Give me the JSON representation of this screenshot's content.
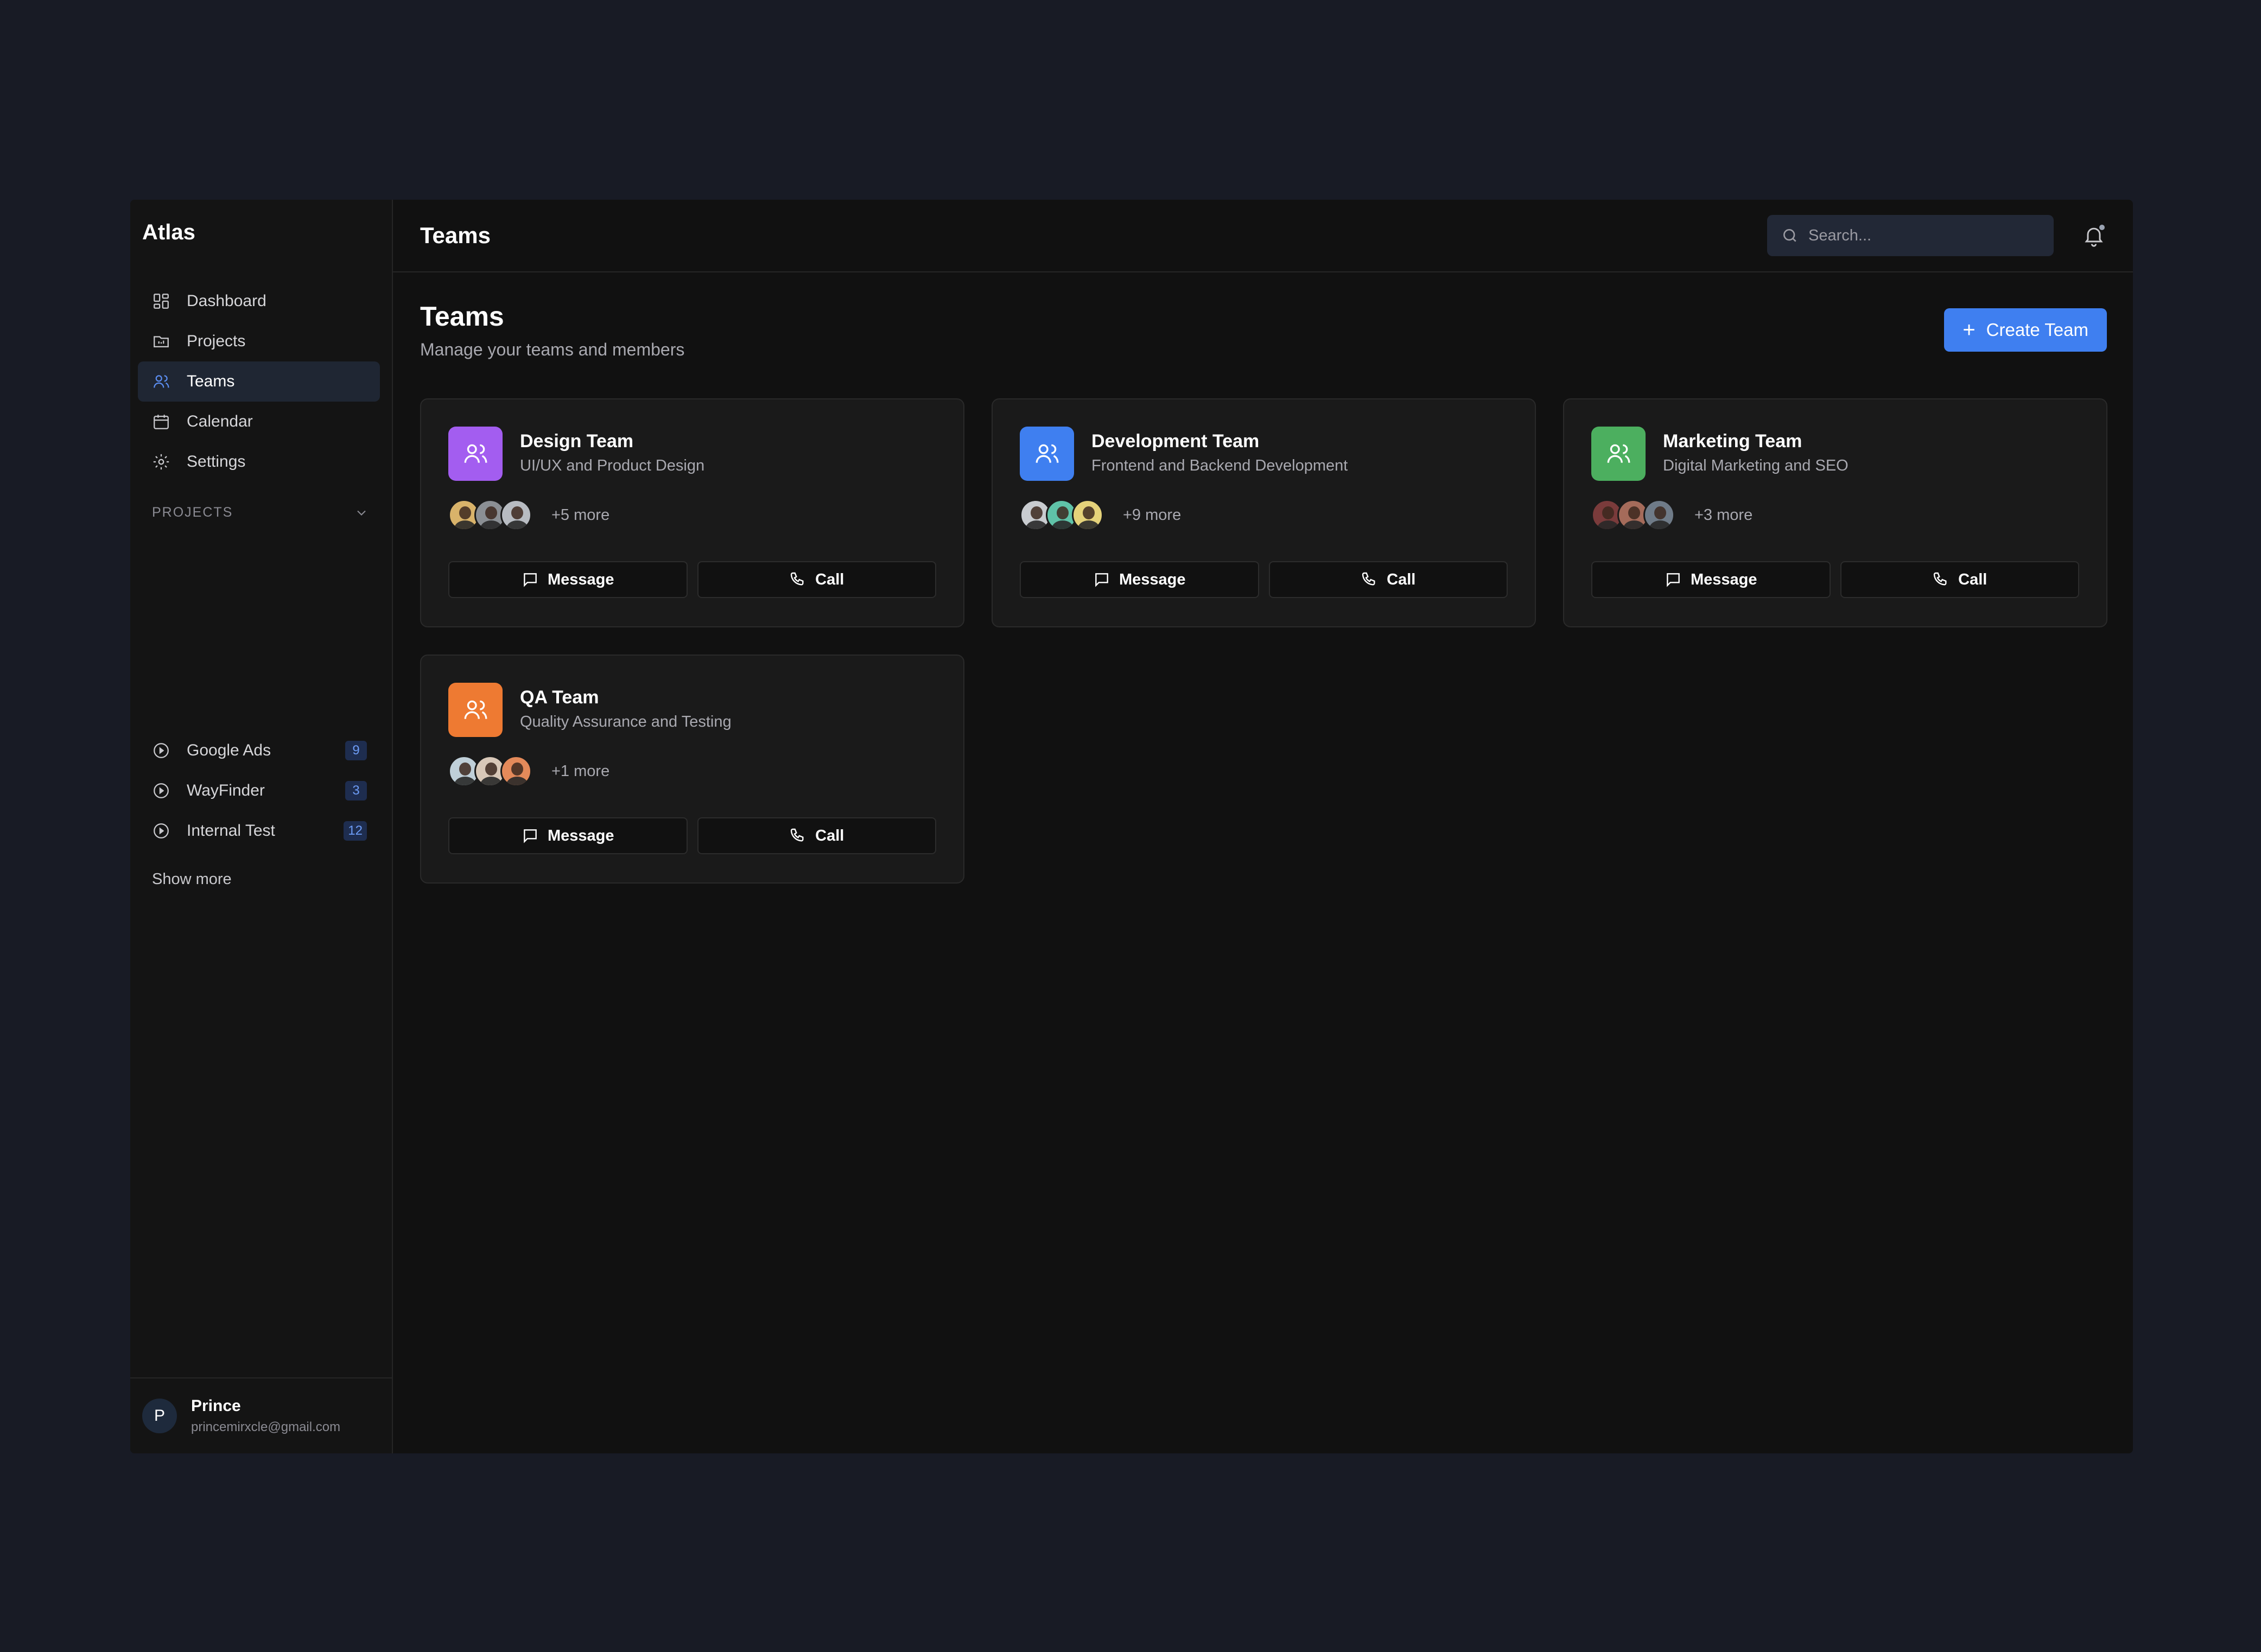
{
  "brand": "Atlas",
  "nav": [
    {
      "label": "Dashboard",
      "icon": "dashboard-icon",
      "active": false
    },
    {
      "label": "Projects",
      "icon": "folder-icon",
      "active": false
    },
    {
      "label": "Teams",
      "icon": "users-icon",
      "active": true
    },
    {
      "label": "Calendar",
      "icon": "calendar-icon",
      "active": false
    },
    {
      "label": "Settings",
      "icon": "gear-icon",
      "active": false
    }
  ],
  "projects_section": {
    "title": "PROJECTS",
    "items": [
      {
        "label": "Google Ads",
        "count": "9"
      },
      {
        "label": "WayFinder",
        "count": "3"
      },
      {
        "label": "Internal Test",
        "count": "12"
      }
    ],
    "show_more": "Show more"
  },
  "user": {
    "initial": "P",
    "name": "Prince",
    "email": "princemirxcle@gmail.com"
  },
  "topbar": {
    "title": "Teams",
    "search_placeholder": "Search..."
  },
  "page": {
    "title": "Teams",
    "subtitle": "Manage your teams and members",
    "create_label": "Create Team"
  },
  "teams": [
    {
      "name": "Design Team",
      "desc": "UI/UX and Product Design",
      "more": "+5 more",
      "color": "#a35df0",
      "faces": [
        "#d9b36a",
        "#8b8f94",
        "#b8bcc2"
      ]
    },
    {
      "name": "Development Team",
      "desc": "Frontend and Backend Development",
      "more": "+9 more",
      "color": "#3f7ff0",
      "faces": [
        "#c9ccd0",
        "#5fc3a8",
        "#e5d27a"
      ]
    },
    {
      "name": "Marketing Team",
      "desc": "Digital Marketing and SEO",
      "more": "+3 more",
      "color": "#4caf5f",
      "faces": [
        "#7a3b3b",
        "#a56b5a",
        "#6f7b88"
      ]
    },
    {
      "name": "QA Team",
      "desc": "Quality Assurance and Testing",
      "more": "+1 more",
      "color": "#ee7a32",
      "faces": [
        "#bfcfd8",
        "#d8c8b8",
        "#e48a5a"
      ]
    }
  ],
  "actions": {
    "message": "Message",
    "call": "Call"
  }
}
